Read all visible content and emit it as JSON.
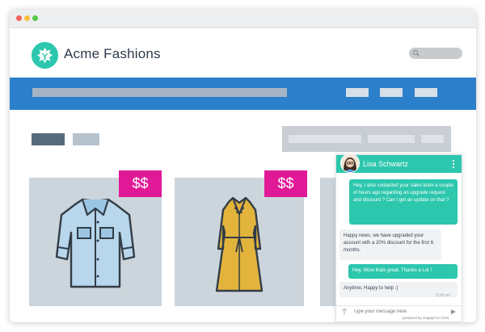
{
  "app": {
    "brand": "Acme Fashions"
  },
  "products": [
    {
      "price": "$$"
    },
    {
      "price": "$$"
    }
  ],
  "chat": {
    "agent_name": "Lisa Schwartz",
    "messages": [
      {
        "from": "user",
        "text": "Hey, I also contacted your sales team a couple of hours ago regarding an upgrade request and discount ? Can I get an update on that ?"
      },
      {
        "from": "agent",
        "text": "Happy news, we have upgraded your account with a 20% discount for the first 6 months."
      },
      {
        "from": "user",
        "text": "Hey, Wow thats great. Thanks a Lot !"
      },
      {
        "from": "agent",
        "text": "Anytime, Happy to help :)"
      }
    ],
    "last_time": "3:34 pm",
    "input_placeholder": "Type your message here",
    "powered_by": "powered by HappyFox Chat"
  },
  "colors": {
    "accent": "#2cc7ad",
    "nav": "#2b7fcb",
    "price": "#e01a97"
  }
}
